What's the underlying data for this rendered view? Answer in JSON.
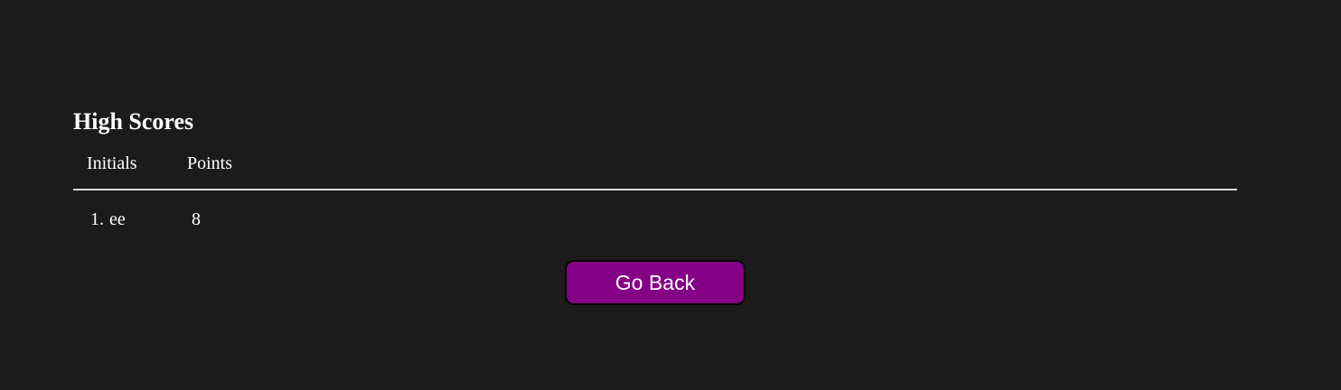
{
  "high_scores": {
    "title": "High Scores",
    "columns": {
      "initials": "Initials",
      "points": "Points"
    },
    "entries": [
      {
        "rank": "1.",
        "initials": "ee",
        "points": "8"
      }
    ]
  },
  "actions": {
    "go_back_label": "Go Back"
  },
  "colors": {
    "background": "#1b1b1b",
    "button": "#840085",
    "text": "#ffffff"
  }
}
